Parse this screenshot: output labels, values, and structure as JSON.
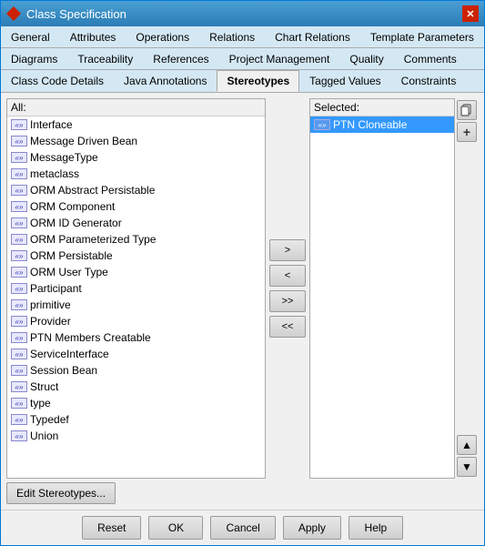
{
  "window": {
    "title": "Class Specification",
    "icon": "diamond-icon"
  },
  "tabs": {
    "row1": [
      {
        "label": "General",
        "active": false
      },
      {
        "label": "Attributes",
        "active": false
      },
      {
        "label": "Operations",
        "active": false
      },
      {
        "label": "Relations",
        "active": false
      },
      {
        "label": "Chart Relations",
        "active": false
      },
      {
        "label": "Template Parameters",
        "active": false
      }
    ],
    "row2": [
      {
        "label": "Diagrams",
        "active": false
      },
      {
        "label": "Traceability",
        "active": false
      },
      {
        "label": "References",
        "active": false
      },
      {
        "label": "Project Management",
        "active": false
      },
      {
        "label": "Quality",
        "active": false
      },
      {
        "label": "Comments",
        "active": false
      }
    ],
    "row3": [
      {
        "label": "Class Code Details",
        "active": false
      },
      {
        "label": "Java Annotations",
        "active": false
      },
      {
        "label": "Stereotypes",
        "active": true
      },
      {
        "label": "Tagged Values",
        "active": false
      },
      {
        "label": "Constraints",
        "active": false
      }
    ]
  },
  "panels": {
    "all_label": "All:",
    "selected_label": "Selected:"
  },
  "all_items": [
    {
      "label": "Interface"
    },
    {
      "label": "Message Driven Bean"
    },
    {
      "label": "MessageType"
    },
    {
      "label": "metaclass"
    },
    {
      "label": "ORM Abstract Persistable"
    },
    {
      "label": "ORM Component"
    },
    {
      "label": "ORM ID Generator"
    },
    {
      "label": "ORM Parameterized Type"
    },
    {
      "label": "ORM Persistable"
    },
    {
      "label": "ORM User Type"
    },
    {
      "label": "Participant"
    },
    {
      "label": "primitive"
    },
    {
      "label": "Provider"
    },
    {
      "label": "PTN Members Creatable"
    },
    {
      "label": "ServiceInterface"
    },
    {
      "label": "Session Bean"
    },
    {
      "label": "Struct"
    },
    {
      "label": "type"
    },
    {
      "label": "Typedef"
    },
    {
      "label": "Union"
    }
  ],
  "selected_items": [
    {
      "label": "PTN Cloneable",
      "selected": true
    }
  ],
  "buttons": {
    "move_right": ">",
    "move_left": "<",
    "move_all_right": ">>",
    "move_all_left": "<<"
  },
  "side_buttons": {
    "copy": "📋",
    "add": "+"
  },
  "nav_buttons": {
    "up": "▲",
    "down": "▼"
  },
  "bottom": {
    "edit_stereotypes": "Edit Stereotypes..."
  },
  "footer": {
    "reset": "Reset",
    "ok": "OK",
    "cancel": "Cancel",
    "apply": "Apply",
    "help": "Help"
  }
}
